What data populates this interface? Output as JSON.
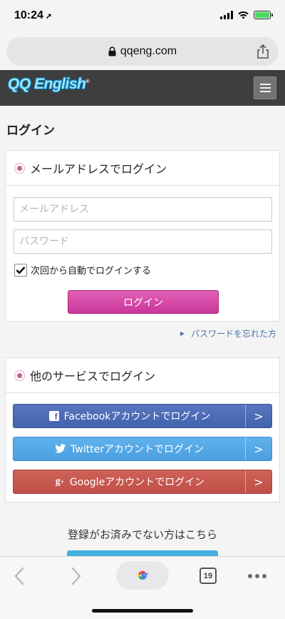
{
  "status_bar": {
    "time": "10:24",
    "location_arrow": "➚"
  },
  "browser": {
    "url": "qqeng.com",
    "tab_count": "19"
  },
  "header": {
    "logo_text": "QQ English",
    "logo_mark": "®"
  },
  "page": {
    "title": "ログイン"
  },
  "email_login": {
    "heading": "メールアドレスでログイン",
    "email_placeholder": "メールアドレス",
    "password_placeholder": "パスワード",
    "remember_label": "次回から自動でログインする",
    "remember_checked": true,
    "submit_label": "ログイン",
    "forgot_label": "パスワードを忘れた方"
  },
  "other_login": {
    "heading": "他のサービスでログイン",
    "facebook_label": "Facebookアカウントでログイン",
    "twitter_label": "Twitterアカウントでログイン",
    "google_label": "Googleアカウントでログイン",
    "chevron": ">"
  },
  "register": {
    "prompt": "登録がお済みでない方はこちら"
  },
  "colors": {
    "header_bg": "#3e3e3e",
    "accent_pink": "#c9379a",
    "facebook": "#4262ad",
    "twitter": "#4b9fe0",
    "google": "#bf5048",
    "link_blue": "#4b74a5",
    "register_blue": "#44b0e0"
  }
}
